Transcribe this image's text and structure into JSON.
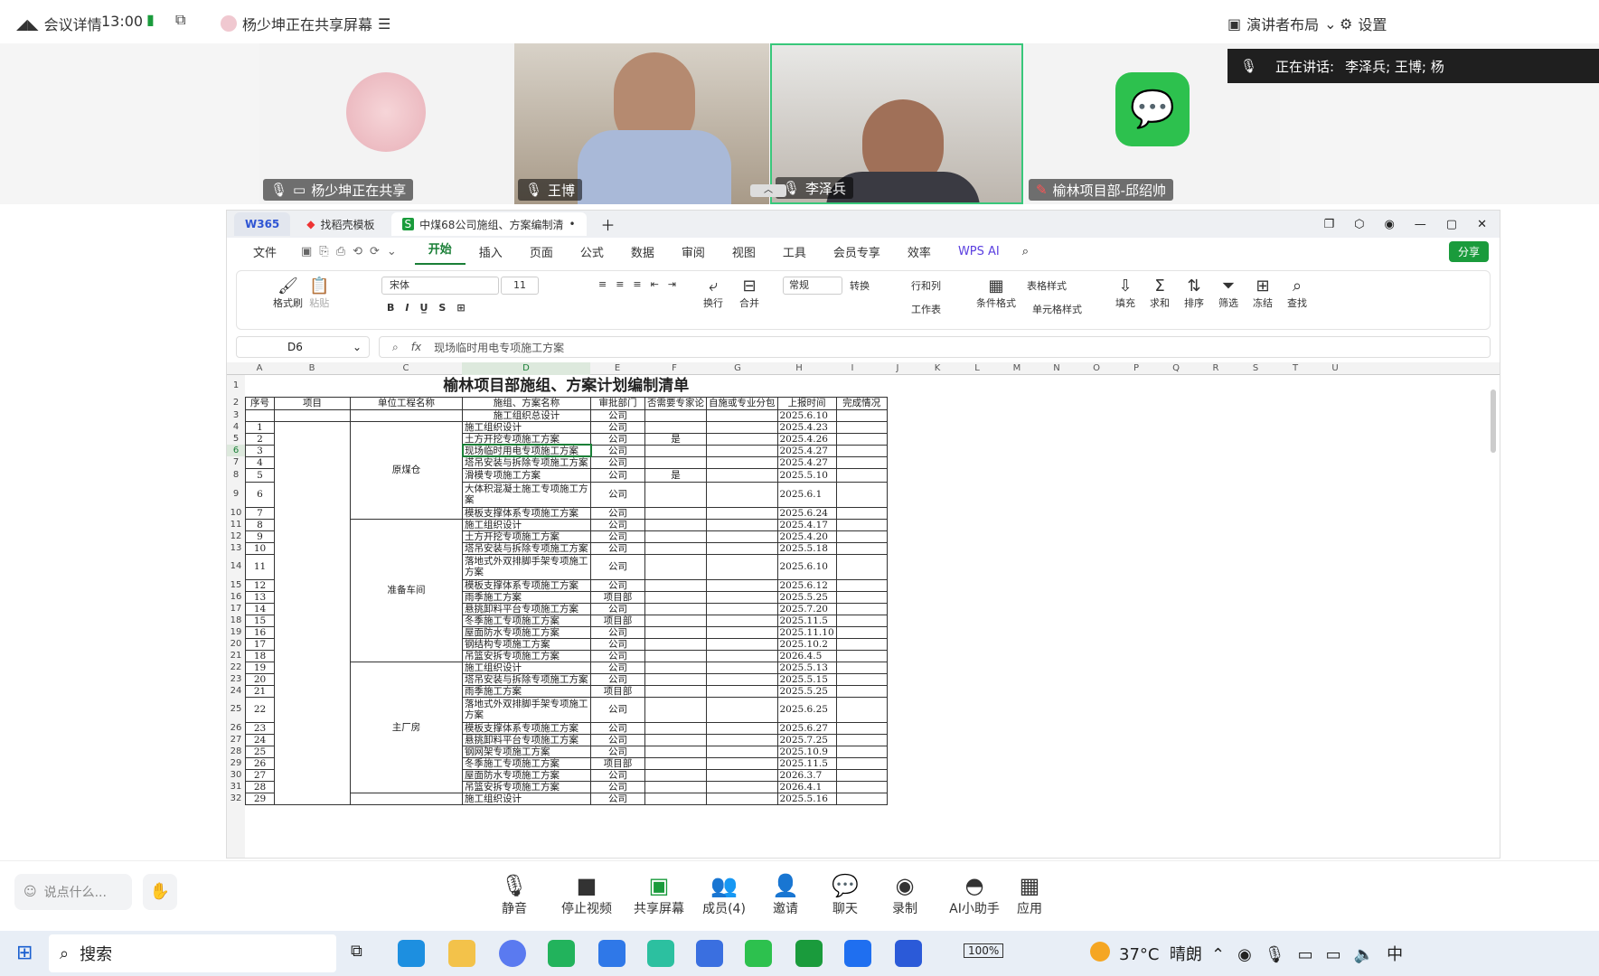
{
  "topbar": {
    "meeting_details": "会议详情",
    "time": "13:00",
    "sharing_notice": "杨少坤正在共享屏幕",
    "layout": "演讲者布局",
    "settings": "设置"
  },
  "speaking": {
    "label": "正在讲话:",
    "names": "李泽兵; 王博; 杨"
  },
  "participants": [
    {
      "name": "杨少坤正在共享"
    },
    {
      "name": "王博"
    },
    {
      "name": "李泽兵"
    },
    {
      "name": "榆林项目部-邱绍帅"
    }
  ],
  "wps": {
    "tabs": [
      "W365",
      "找稻壳模板",
      "中煤68公司施组、方案编制清"
    ],
    "menus": [
      "文件",
      "开始",
      "插入",
      "页面",
      "公式",
      "数据",
      "审阅",
      "视图",
      "工具",
      "会员专享",
      "效率",
      "WPS AI"
    ],
    "share": "分享",
    "ribbon": {
      "format_painter": "格式刷",
      "paste": "粘贴",
      "font": "宋体",
      "size": "11",
      "wrap": "换行",
      "merge": "合并",
      "number_format": "常规",
      "convert": "转换",
      "rowcol": "行和列",
      "worksheet": "工作表",
      "cond_format": "条件格式",
      "table_style": "表格样式",
      "cell_style": "单元格样式",
      "fill": "填充",
      "sum": "求和",
      "sort": "排序",
      "filter": "筛选",
      "freeze": "冻结",
      "find": "查找"
    },
    "cell_ref": "D6",
    "formula": "现场临时用电专项施工方案"
  },
  "sheet": {
    "title": "榆林项目部施组、方案计划编制清单",
    "columns": [
      "A",
      "B",
      "C",
      "D",
      "E",
      "F",
      "G",
      "H",
      "I",
      "J",
      "K",
      "L",
      "M",
      "N",
      "O",
      "P",
      "Q",
      "R",
      "S",
      "T",
      "U"
    ],
    "headers": [
      "序号",
      "项目",
      "单位工程名称",
      "施组、方案名称",
      "审批部门",
      "否需要专家论",
      "自施或专业分包",
      "上报时间",
      "完成情况"
    ],
    "groups": [
      "原煤仓",
      "准备车间",
      "主厂房"
    ],
    "rows": [
      [
        "",
        "施工组织总设计",
        "公司",
        "",
        "2025.6.10"
      ],
      [
        "1",
        "施工组织设计",
        "公司",
        "",
        "2025.4.23"
      ],
      [
        "2",
        "土方开挖专项施工方案",
        "公司",
        "是",
        "2025.4.26"
      ],
      [
        "3",
        "现场临时用电专项施工方案",
        "公司",
        "",
        "2025.4.27"
      ],
      [
        "4",
        "塔吊安装与拆除专项施工方案",
        "公司",
        "",
        "2025.4.27"
      ],
      [
        "5",
        "滑模专项施工方案",
        "公司",
        "是",
        "2025.5.10"
      ],
      [
        "6",
        "大体积混凝土施工专项施工方案",
        "公司",
        "",
        "2025.6.1"
      ],
      [
        "7",
        "模板支撑体系专项施工方案",
        "公司",
        "",
        "2025.6.24"
      ],
      [
        "8",
        "施工组织设计",
        "公司",
        "",
        "2025.4.17"
      ],
      [
        "9",
        "土方开挖专项施工方案",
        "公司",
        "",
        "2025.4.20"
      ],
      [
        "10",
        "塔吊安装与拆除专项施工方案",
        "公司",
        "",
        "2025.5.18"
      ],
      [
        "11",
        "落地式外双排脚手架专项施工方案",
        "公司",
        "",
        "2025.6.10"
      ],
      [
        "12",
        "模板支撑体系专项施工方案",
        "公司",
        "",
        "2025.6.12"
      ],
      [
        "13",
        "雨季施工方案",
        "项目部",
        "",
        "2025.5.25"
      ],
      [
        "14",
        "悬挑卸料平台专项施工方案",
        "公司",
        "",
        "2025.7.20"
      ],
      [
        "15",
        "冬季施工专项施工方案",
        "项目部",
        "",
        "2025.11.5"
      ],
      [
        "16",
        "屋面防水专项施工方案",
        "公司",
        "",
        "2025.11.10"
      ],
      [
        "17",
        "钢结构专项施工方案",
        "公司",
        "",
        "2025.10.2"
      ],
      [
        "18",
        "吊篮安拆专项施工方案",
        "公司",
        "",
        "2026.4.5"
      ],
      [
        "19",
        "施工组织设计",
        "公司",
        "",
        "2025.5.13"
      ],
      [
        "20",
        "塔吊安装与拆除专项施工方案",
        "公司",
        "",
        "2025.5.15"
      ],
      [
        "21",
        "雨季施工方案",
        "项目部",
        "",
        "2025.5.25"
      ],
      [
        "22",
        "落地式外双排脚手架专项施工方案",
        "公司",
        "",
        "2025.6.25"
      ],
      [
        "23",
        "模板支撑体系专项施工方案",
        "公司",
        "",
        "2025.6.27"
      ],
      [
        "24",
        "悬挑卸料平台专项施工方案",
        "公司",
        "",
        "2025.7.25"
      ],
      [
        "25",
        "钢网架专项施工方案",
        "公司",
        "",
        "2025.10.9"
      ],
      [
        "26",
        "冬季施工专项施工方案",
        "项目部",
        "",
        "2025.11.5"
      ],
      [
        "27",
        "屋面防水专项施工方案",
        "公司",
        "",
        "2026.3.7"
      ],
      [
        "28",
        "吊篮安拆专项施工方案",
        "公司",
        "",
        "2026.4.1"
      ],
      [
        "29",
        "施工组织设计",
        "公司",
        "",
        "2025.5.16"
      ]
    ]
  },
  "bottom": {
    "chat_placeholder": "说点什么...",
    "buttons": [
      "静音",
      "停止视频",
      "共享屏幕",
      "成员(4)",
      "邀请",
      "聊天",
      "录制",
      "AI小助手",
      "应用"
    ]
  },
  "taskbar": {
    "search": "搜索",
    "battery": "100%",
    "weather": "37°C  晴朗"
  }
}
